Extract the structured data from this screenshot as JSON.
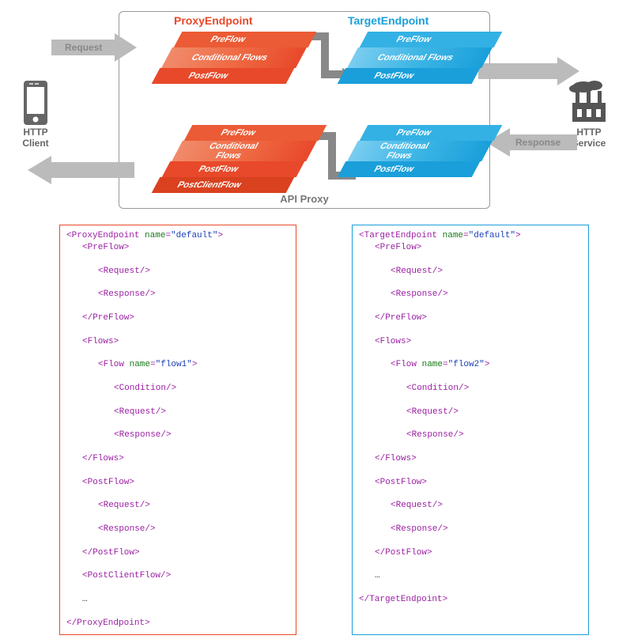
{
  "titles": {
    "proxy": "ProxyEndpoint",
    "target": "TargetEndpoint",
    "apiProxy": "API Proxy"
  },
  "labels": {
    "request": "Request",
    "response": "Response",
    "httpClient": "HTTP\nClient",
    "httpService": "HTTP\nService"
  },
  "flows": {
    "pre": "PreFlow",
    "cond": "Conditional\nFlows",
    "condOne": "Conditional Flows",
    "post": "PostFlow",
    "postClient": "PostClientFlow"
  },
  "code": {
    "proxy": {
      "rootOpen": "<ProxyEndpoint name=\"default\">",
      "rootClose": "</ProxyEndpoint>",
      "flowName": "flow1",
      "hasPostClient": true
    },
    "target": {
      "rootOpen": "<TargetEndpoint name=\"default\">",
      "rootClose": "</TargetEndpoint>",
      "flowName": "flow2",
      "hasPostClient": false
    },
    "common": {
      "preOpen": "<PreFlow>",
      "preClose": "</PreFlow>",
      "request": "<Request/>",
      "response": "<Response/>",
      "flowsOpen": "<Flows>",
      "flowsClose": "</Flows>",
      "flowOpenPrefix": "<Flow name=\"",
      "flowOpenSuffix": "\">",
      "condition": "<Condition/>",
      "postOpen": "<PostFlow>",
      "postClose": "</PostFlow>",
      "postClient": "<PostClientFlow/>",
      "ellipsis": "…"
    }
  }
}
